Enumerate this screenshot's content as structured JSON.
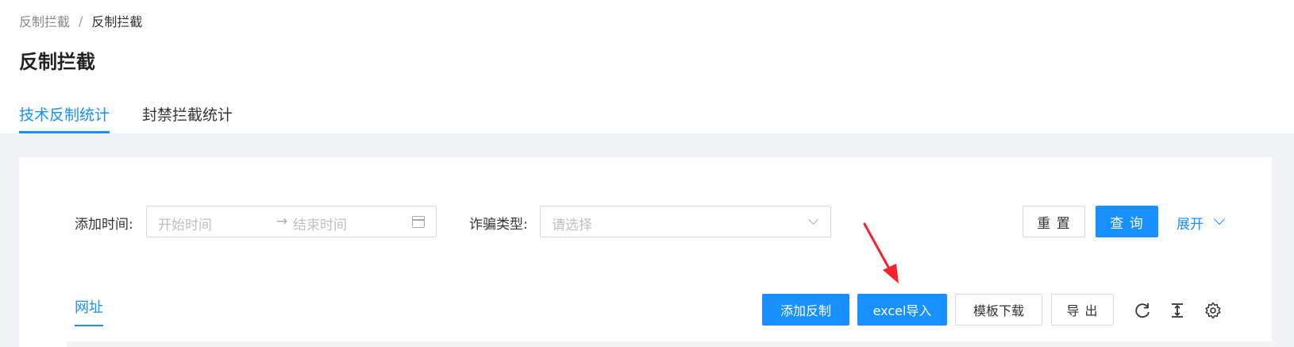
{
  "breadcrumb": {
    "parent": "反制拦截",
    "separator": "/",
    "current": "反制拦截"
  },
  "page_title": "反制拦截",
  "tabs": [
    {
      "label": "技术反制统计",
      "active": true
    },
    {
      "label": "封禁拦截统计",
      "active": false
    }
  ],
  "filters": {
    "time_label": "添加时间:",
    "start_placeholder": "开始时间",
    "range_arrow": "→",
    "end_placeholder": "结束时间",
    "calendar_icon": "calendar-icon",
    "type_label": "诈骗类型:",
    "type_placeholder": "请选择"
  },
  "actions": {
    "reset": "重 置",
    "query": "查 询",
    "expand": "展开"
  },
  "sub_tabs": [
    {
      "label": "网址",
      "active": true
    }
  ],
  "toolbar": {
    "add": "添加反制",
    "excel_import": "excel导入",
    "template_download": "模板下载",
    "export": "导 出",
    "icons": [
      "refresh-icon",
      "column-height-icon",
      "settings-icon"
    ]
  },
  "colors": {
    "primary": "#1890ff",
    "annotation_arrow": "#f5222d",
    "background": "#f0f2f5"
  }
}
